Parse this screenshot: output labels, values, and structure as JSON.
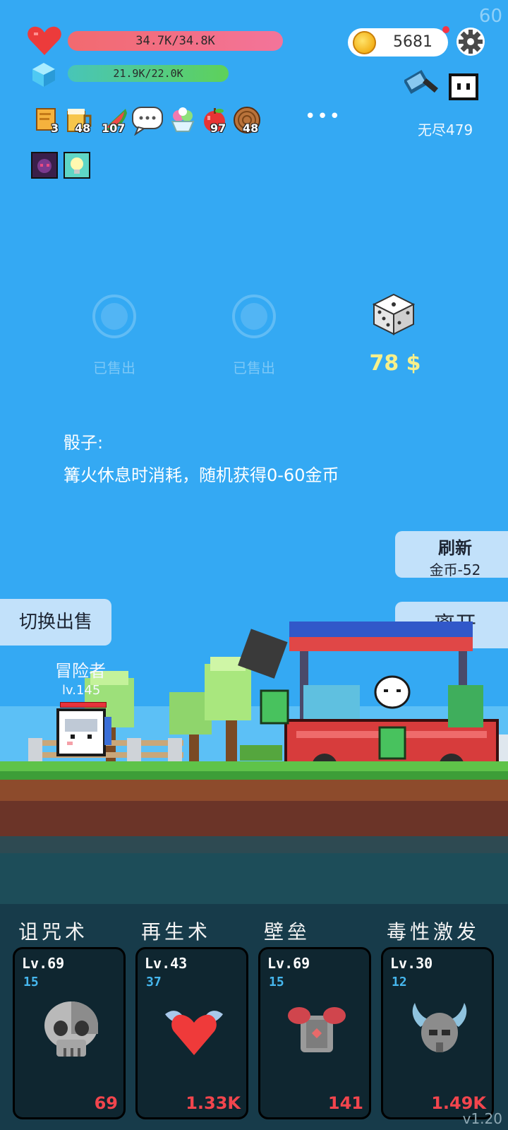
{
  "fps": "60",
  "status": {
    "hp": "34.7K/34.8K",
    "mp": "21.9K/22.0K",
    "coins": "5681",
    "endless": "无尽479"
  },
  "items": [
    {
      "icon": "scroll-icon",
      "count": "3"
    },
    {
      "icon": "beer-icon",
      "count": "48"
    },
    {
      "icon": "watermelon-icon",
      "count": "107"
    },
    {
      "icon": "chat-bubble-icon",
      "count": ""
    },
    {
      "icon": "ice-cream-icon",
      "count": ""
    },
    {
      "icon": "apple-icon",
      "count": "97"
    },
    {
      "icon": "wood-log-icon",
      "count": "48"
    }
  ],
  "more": "•••",
  "shop": {
    "slot1_label": "已售出",
    "slot2_label": "已售出",
    "slot3_price": "78 $"
  },
  "description": {
    "title": "骰子:",
    "text": "篝火休息时消耗，随机获得0-60金币"
  },
  "buttons": {
    "refresh_title": "刷新",
    "refresh_cost": "金币-52",
    "leave": "离开",
    "switch": "切换出售"
  },
  "hero": {
    "name": "冒险者",
    "level": "lv.145"
  },
  "skills": [
    {
      "name": "诅咒术",
      "level": "Lv.69",
      "cost": "15",
      "value": "69",
      "icon": "skull-icon"
    },
    {
      "name": "再生术",
      "level": "Lv.43",
      "cost": "37",
      "value": "1.33K",
      "icon": "winged-heart-icon"
    },
    {
      "name": "壁垒",
      "level": "Lv.69",
      "cost": "15",
      "value": "141",
      "icon": "armor-icon"
    },
    {
      "name": "毒性激发",
      "level": "Lv.30",
      "cost": "12",
      "value": "1.49K",
      "icon": "horned-helmet-icon"
    }
  ],
  "version": "v1.20",
  "colors": {
    "sky": "#34a9f3",
    "hp_bar": "#f26a6f",
    "mp_bar": "#5ed15a",
    "price": "#f7f08b",
    "skill_value": "#f2454d",
    "skill_cost": "#46b7ee"
  }
}
